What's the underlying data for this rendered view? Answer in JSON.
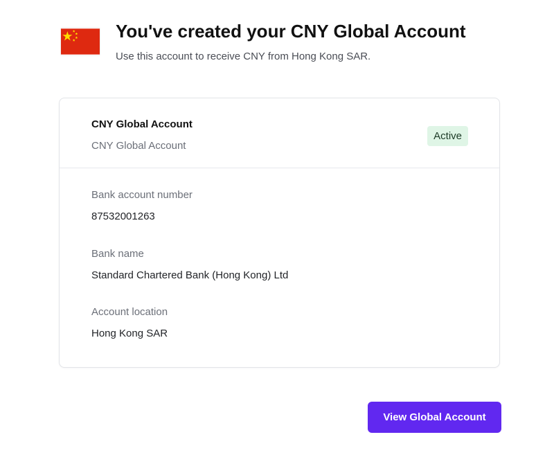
{
  "header": {
    "flag_icon": "china-flag-icon",
    "title": "You've created your CNY Global Account",
    "subtitle": "Use this account to receive CNY from Hong Kong SAR."
  },
  "card": {
    "account_name": "CNY Global Account",
    "account_subtitle": "CNY Global Account",
    "status_badge": "Active",
    "fields": [
      {
        "label": "Bank account number",
        "value": "87532001263"
      },
      {
        "label": "Bank name",
        "value": "Standard Chartered Bank (Hong Kong) Ltd"
      },
      {
        "label": "Account location",
        "value": "Hong Kong SAR"
      }
    ]
  },
  "actions": {
    "view_button_label": "View Global Account"
  },
  "colors": {
    "accent": "#6128f0",
    "badge_bg": "#dff5e6",
    "flag_red": "#de2910",
    "flag_yellow": "#ffde00"
  }
}
